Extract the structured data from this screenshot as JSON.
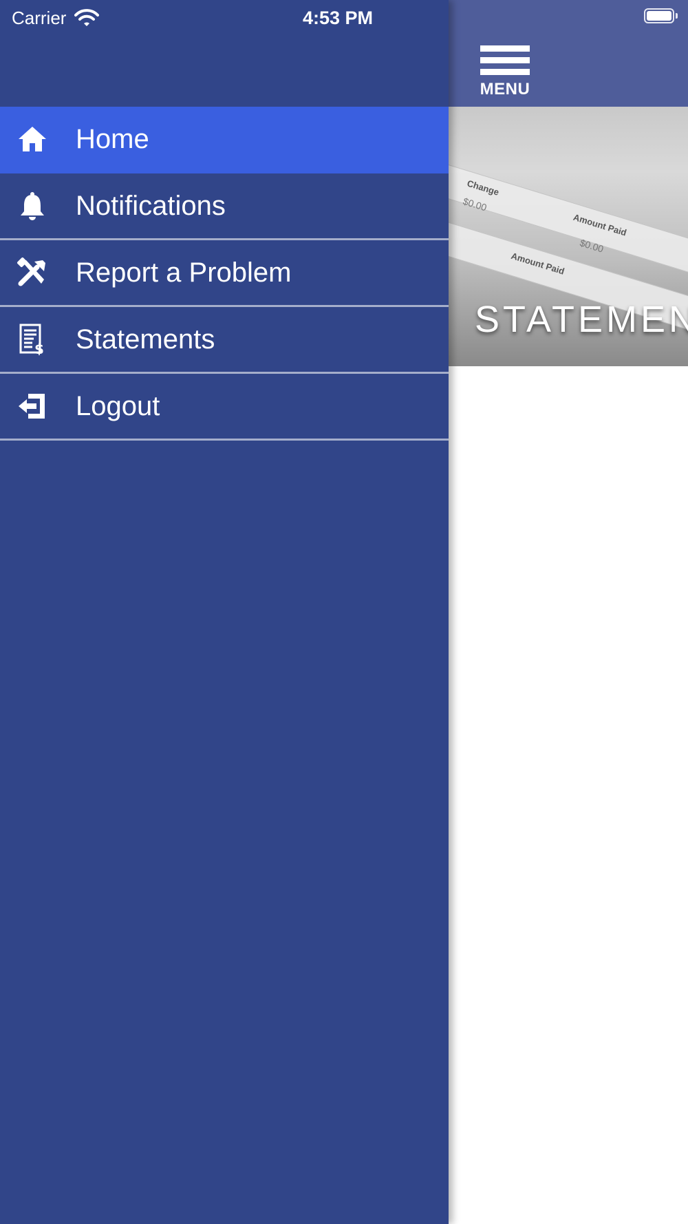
{
  "status_bar": {
    "carrier": "Carrier",
    "time": "4:53 PM"
  },
  "header": {
    "menu_label": "MENU"
  },
  "hero": {
    "title": "STATEMENTS",
    "paper_text": {
      "col_change": "Change",
      "col_amount_paid": "Amount Paid",
      "amount": "$0.00"
    }
  },
  "drawer": {
    "items": [
      {
        "label": "Home",
        "icon": "home-icon",
        "active": true
      },
      {
        "label": "Notifications",
        "icon": "bell-icon",
        "active": false
      },
      {
        "label": "Report a Problem",
        "icon": "tools-icon",
        "active": false
      },
      {
        "label": "Statements",
        "icon": "statement-icon",
        "active": false
      },
      {
        "label": "Logout",
        "icon": "logout-icon",
        "active": false
      }
    ]
  },
  "colors": {
    "drawer_bg": "#314589",
    "active_item_bg": "#3a5fe0",
    "header_bg": "#4f5d9a",
    "divider": "#a5aecb"
  }
}
